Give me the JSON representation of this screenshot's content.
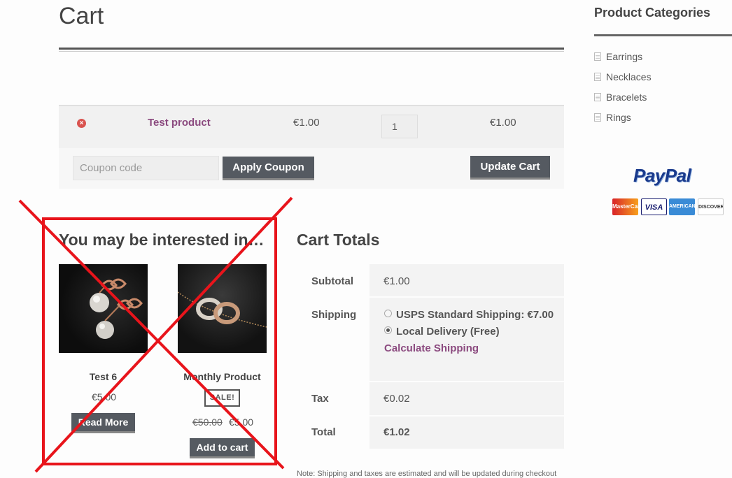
{
  "page": {
    "title": "Cart"
  },
  "cart": {
    "items": [
      {
        "name": "Test product",
        "price": "€1.00",
        "quantity": "1",
        "total": "€1.00"
      }
    ],
    "coupon_placeholder": "Coupon code",
    "apply_coupon_label": "Apply Coupon",
    "update_cart_label": "Update Cart"
  },
  "interested": {
    "title": "You may be interested in…",
    "products": [
      {
        "name": "Test 6",
        "price": "€5.00",
        "button": "Read More"
      },
      {
        "name": "Monthly Product",
        "badge": "SALE!",
        "old_price": "€50.00",
        "new_price": "€5.00",
        "button": "Add to cart"
      }
    ]
  },
  "totals": {
    "title": "Cart Totals",
    "subtotal_label": "Subtotal",
    "subtotal_value": "€1.00",
    "shipping_label": "Shipping",
    "shipping_options": [
      {
        "label": "USPS Standard Shipping: €7.00",
        "selected": false
      },
      {
        "label": "Local Delivery (Free)",
        "selected": true
      }
    ],
    "calculate_shipping": "Calculate Shipping",
    "tax_label": "Tax",
    "tax_value": "€0.02",
    "total_label": "Total",
    "total_value": "€1.02",
    "note": "Note: Shipping and taxes are estimated and will be updated during checkout"
  },
  "sidebar": {
    "title": "Product Categories",
    "items": [
      {
        "label": "Earrings"
      },
      {
        "label": "Necklaces"
      },
      {
        "label": "Bracelets"
      },
      {
        "label": "Rings"
      }
    ],
    "paypal": "PayPal",
    "cards": [
      "MasterCard",
      "VISA",
      "AMERICAN EXPRESS",
      "DISCOVER"
    ]
  },
  "colors": {
    "accent_link": "#8b4a7f",
    "button_bg": "#555a61",
    "overlay_red": "#e8141b"
  }
}
